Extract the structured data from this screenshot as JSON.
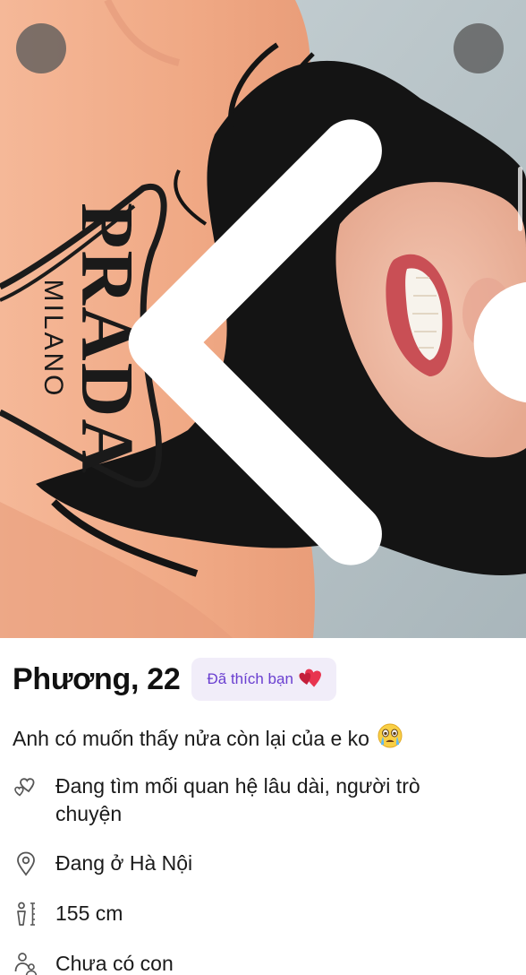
{
  "profile": {
    "name_age": "Phương, 22",
    "liked_badge": "Đã thích bạn",
    "bio": "Anh có muốn thấy nửa còn lại của e ko",
    "photo_shirt_text": {
      "line1": "PRADA",
      "line2": "MILANO"
    }
  },
  "details": [
    {
      "icon": "hearts-icon",
      "text": "Đang tìm mối quan hệ lâu dài, người trò chuyện"
    },
    {
      "icon": "location-pin-icon",
      "text": "Đang ở Hà Nội"
    },
    {
      "icon": "height-icon",
      "text": "155 cm"
    },
    {
      "icon": "children-icon",
      "text": "Chưa có con"
    }
  ],
  "colors": {
    "badge_bg": "#f1edf9",
    "badge_text": "#6a3fd0",
    "shirt": "#f2ae8c",
    "hair": "#111111",
    "overlay_button": "#5a5a5a"
  }
}
